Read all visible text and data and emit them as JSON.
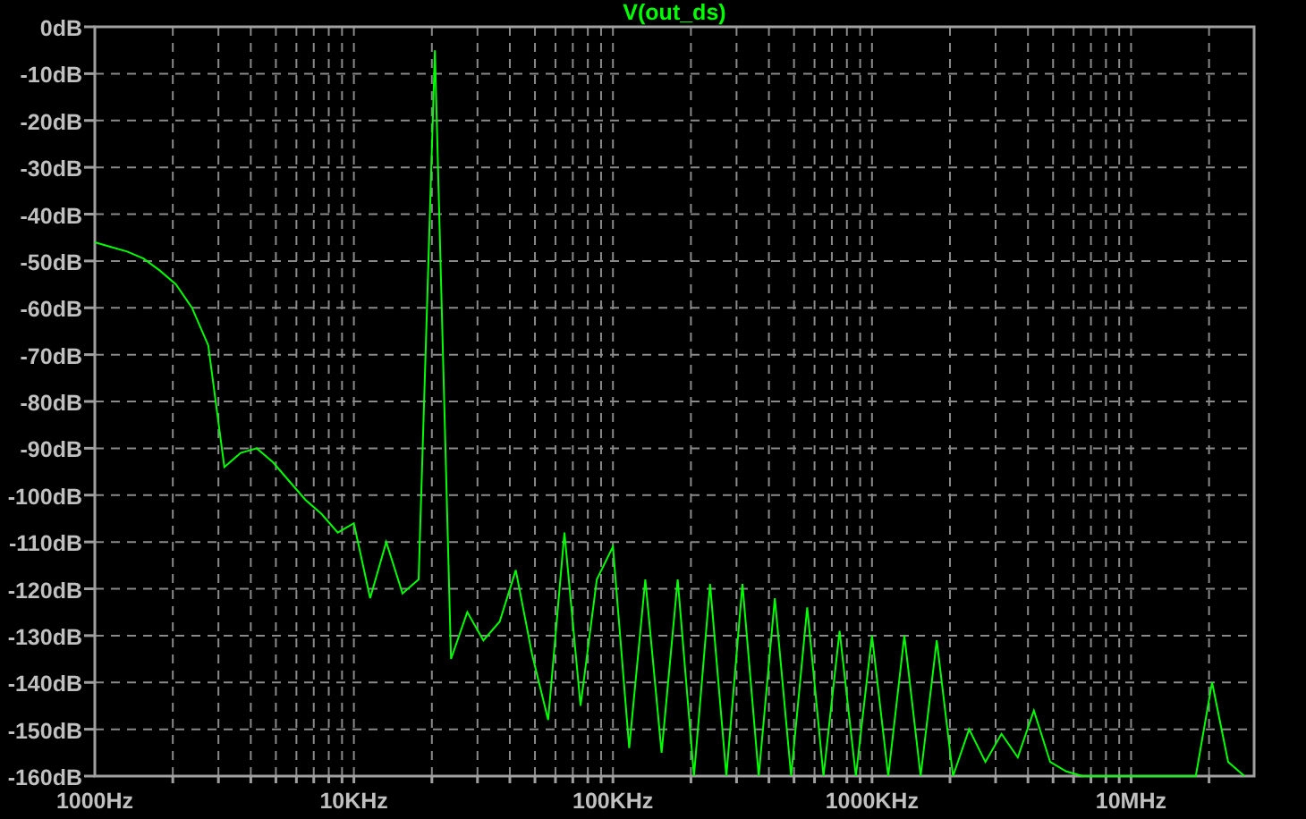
{
  "chart_data": {
    "type": "line",
    "grid": true,
    "ylim": [
      -160,
      0
    ],
    "categories": [
      "1000Hz",
      null,
      null,
      null,
      null,
      null,
      null,
      null,
      null,
      null,
      null,
      null,
      null,
      null,
      null,
      null,
      "10KHz",
      null,
      null,
      null,
      null,
      null,
      null,
      null,
      null,
      null,
      null,
      null,
      null,
      null,
      null,
      null,
      "100KHz",
      null,
      null,
      null,
      null,
      null,
      null,
      null,
      null,
      null,
      null,
      null,
      null,
      null,
      null,
      null,
      "1000KHz",
      null,
      null,
      null,
      null,
      null,
      null,
      null,
      null,
      null,
      null,
      null,
      null,
      null,
      null,
      null,
      "10MHz",
      null,
      null,
      null,
      null,
      null,
      null,
      null
    ],
    "yticks": [
      {
        "value": 0,
        "label": "0dB"
      },
      {
        "value": -10,
        "label": "-10dB"
      },
      {
        "value": -20,
        "label": "-20dB"
      },
      {
        "value": -30,
        "label": "-30dB"
      },
      {
        "value": -40,
        "label": "-40dB"
      },
      {
        "value": -50,
        "label": "-50dB"
      },
      {
        "value": -60,
        "label": "-60dB"
      },
      {
        "value": -70,
        "label": "-70dB"
      },
      {
        "value": -80,
        "label": "-80dB"
      },
      {
        "value": -90,
        "label": "-90dB"
      },
      {
        "value": -100,
        "label": "-100dB"
      },
      {
        "value": -110,
        "label": "-110dB"
      },
      {
        "value": -120,
        "label": "-120dB"
      },
      {
        "value": -130,
        "label": "-130dB"
      },
      {
        "value": -140,
        "label": "-140dB"
      },
      {
        "value": -150,
        "label": "-150dB"
      },
      {
        "value": -160,
        "label": "-160dB"
      }
    ],
    "series": [
      {
        "name": "V(out_ds)",
        "color": "#00ff00",
        "values": [
          -46,
          -47,
          -48,
          -49.5,
          -52,
          -55,
          -60,
          -68,
          -94,
          -91,
          -90,
          -93,
          -97,
          -101,
          -104,
          -108,
          -106,
          -122,
          -110,
          -121,
          -118,
          -5,
          -135,
          -125,
          -131,
          -127,
          -116,
          -134,
          -148,
          -108,
          -145,
          -118,
          -111,
          -154,
          -118,
          -155,
          -118,
          -160,
          -119,
          -160,
          -119,
          -160,
          -122,
          -160,
          -124,
          -160,
          -129,
          -160,
          -130,
          -160,
          -130,
          -160,
          -131,
          -160,
          -150,
          -157,
          -151,
          -156,
          -146,
          -157,
          -159,
          -160,
          -160,
          -160,
          -160,
          -160,
          -160,
          -160,
          -160,
          -140,
          -157,
          -160
        ]
      }
    ]
  }
}
